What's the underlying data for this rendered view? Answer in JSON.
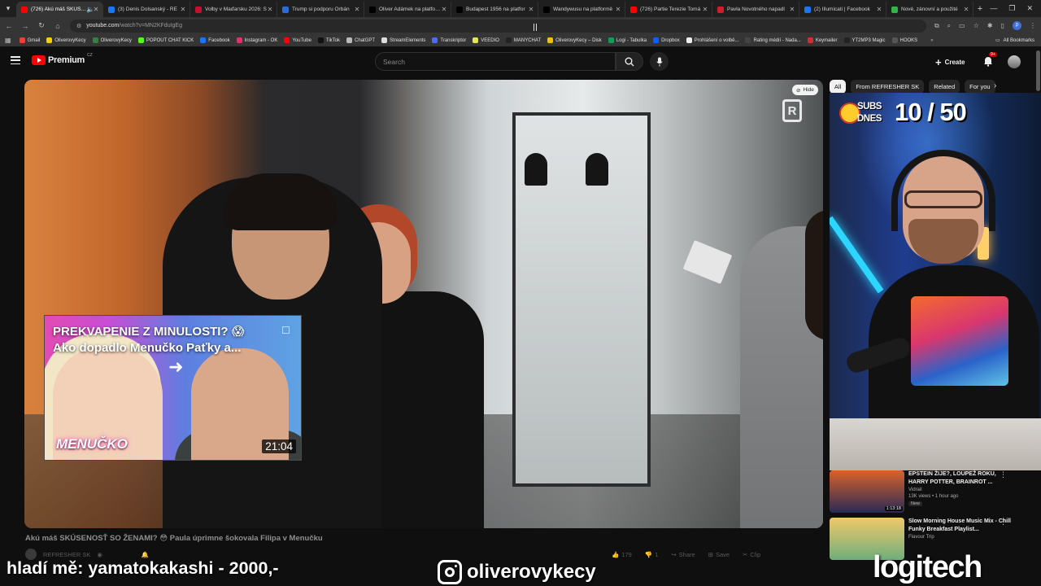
{
  "browser": {
    "tabs": [
      {
        "title": "(726) Akú máš SKÚSEN",
        "favicon_color": "#ff0000",
        "active": true
      },
      {
        "title": "(3) Denis Dolsanský - RE",
        "favicon_color": "#1877f2",
        "active": false
      },
      {
        "title": "Volby v Maďarsku 2026: S",
        "favicon_color": "#c8102e",
        "active": false
      },
      {
        "title": "Trump si podporu Orbán",
        "favicon_color": "#2d6bd6",
        "active": false
      },
      {
        "title": "Oliver Adámek na platform",
        "favicon_color": "#000000",
        "active": false
      },
      {
        "title": "Budapest 1956 na platfor",
        "favicon_color": "#000000",
        "active": false
      },
      {
        "title": "Wandywusu na platformě",
        "favicon_color": "#000000",
        "active": false
      },
      {
        "title": "(726) Partie Terezie Tomá",
        "favicon_color": "#ff0000",
        "active": false
      },
      {
        "title": "Pavla Novotného napadl",
        "favicon_color": "#d01c2c",
        "active": false
      },
      {
        "title": "(2) Illumicati | Facebook",
        "favicon_color": "#1877f2",
        "active": false
      },
      {
        "title": "Nové, zánovní a použité",
        "favicon_color": "#36b24a",
        "active": false
      }
    ],
    "url_host": "youtube.com",
    "url_path": "/watch?v=MN2KFduIgEg",
    "profile_initial": "P",
    "bookmarks": [
      {
        "label": "Gmail",
        "color": "#ea4335"
      },
      {
        "label": "OliverovyKecy",
        "color": "#ffcc00"
      },
      {
        "label": "OliverovyKecy",
        "color": "#3a7d44"
      },
      {
        "label": "POPOUT CHAT KICK",
        "color": "#53fc18"
      },
      {
        "label": "Facebook",
        "color": "#1877f2"
      },
      {
        "label": "Instagram - OK",
        "color": "#e1306c"
      },
      {
        "label": "YouTube",
        "color": "#ff0000"
      },
      {
        "label": "TikTok",
        "color": "#111111"
      },
      {
        "label": "ChatGPT",
        "color": "#bbbbbb"
      },
      {
        "label": "StreamElements",
        "color": "#dddddd"
      },
      {
        "label": "Transkriptor",
        "color": "#4a6cf7"
      },
      {
        "label": "VEEDIO",
        "color": "#e5e84b"
      },
      {
        "label": "MANYCHAT",
        "color": "#222222"
      },
      {
        "label": "OliverovyKecy – Disk",
        "color": "#fbbc04"
      },
      {
        "label": "Logi - Tabulka",
        "color": "#0f9d58"
      },
      {
        "label": "Dropbox",
        "color": "#0061ff"
      },
      {
        "label": "Prohlášení o volbě...",
        "color": "#eeeeee"
      },
      {
        "label": "Rating médií - Nada...",
        "color": "#444444"
      },
      {
        "label": "Keymailer",
        "color": "#d23030"
      },
      {
        "label": "YT2MP3 Magic",
        "color": "#222222"
      },
      {
        "label": "HOOKS",
        "color": "#555555"
      }
    ],
    "all_bookmarks_label": "All Bookmarks"
  },
  "youtube": {
    "logo_word": "Premium",
    "country_code": "CZ",
    "search_placeholder": "Search",
    "create_label": "Create",
    "notifications_badge": "9+",
    "player": {
      "hide_label": "Hide",
      "watermark": "R",
      "endcard": {
        "title_line1": "PREKVAPENIE Z MINULOSTI? 😱",
        "title_line2": "Ako dopadlo Menučko Paťky a...",
        "brand": "MENUČKO",
        "duration": "21:04"
      }
    },
    "video_title": "Akú máš SKÚSENOSŤ SO ŽENAMI? 😳 Paula úprimne šokovala Filipa v Menučku",
    "channel_name": "REFRESHER SK",
    "actions": [
      {
        "icon": "👍",
        "label": "179"
      },
      {
        "icon": "👎",
        "label": "1"
      },
      {
        "icon": "↪",
        "label": "Share"
      },
      {
        "icon": "⊞",
        "label": "Save"
      },
      {
        "icon": "✂",
        "label": "Clip"
      }
    ],
    "chips": [
      "All",
      "From REFRESHER SK",
      "Related",
      "For you"
    ],
    "recommendations": [
      {
        "title": "EPSTEIN ŽIJE?, LOUPEŽ ROKU, HARRY POTTER, BRAINROT ...",
        "channel": "Vidrail",
        "meta": "13K views • 1 hour ago",
        "badge": "New",
        "duration": "1:13:18",
        "thumb_top": "#d8622b",
        "thumb_bottom": "#2a2a55"
      },
      {
        "title": "Slow Morning House Music Mix - Chill Funky Breakfast Playlist...",
        "channel": "Flavour Trip",
        "meta": "",
        "badge": "",
        "duration": "",
        "thumb_top": "#f0c86a",
        "thumb_bottom": "#6fae7a"
      }
    ]
  },
  "stream_overlay": {
    "subs_label_line1": "SUBS",
    "subs_label_line2": "DNES",
    "subs_count": "10 / 50",
    "left_text": "hladí mě: yamatokakashi - 2000,-",
    "instagram_handle": "oliverovykecy",
    "sponsor": "logitech"
  }
}
